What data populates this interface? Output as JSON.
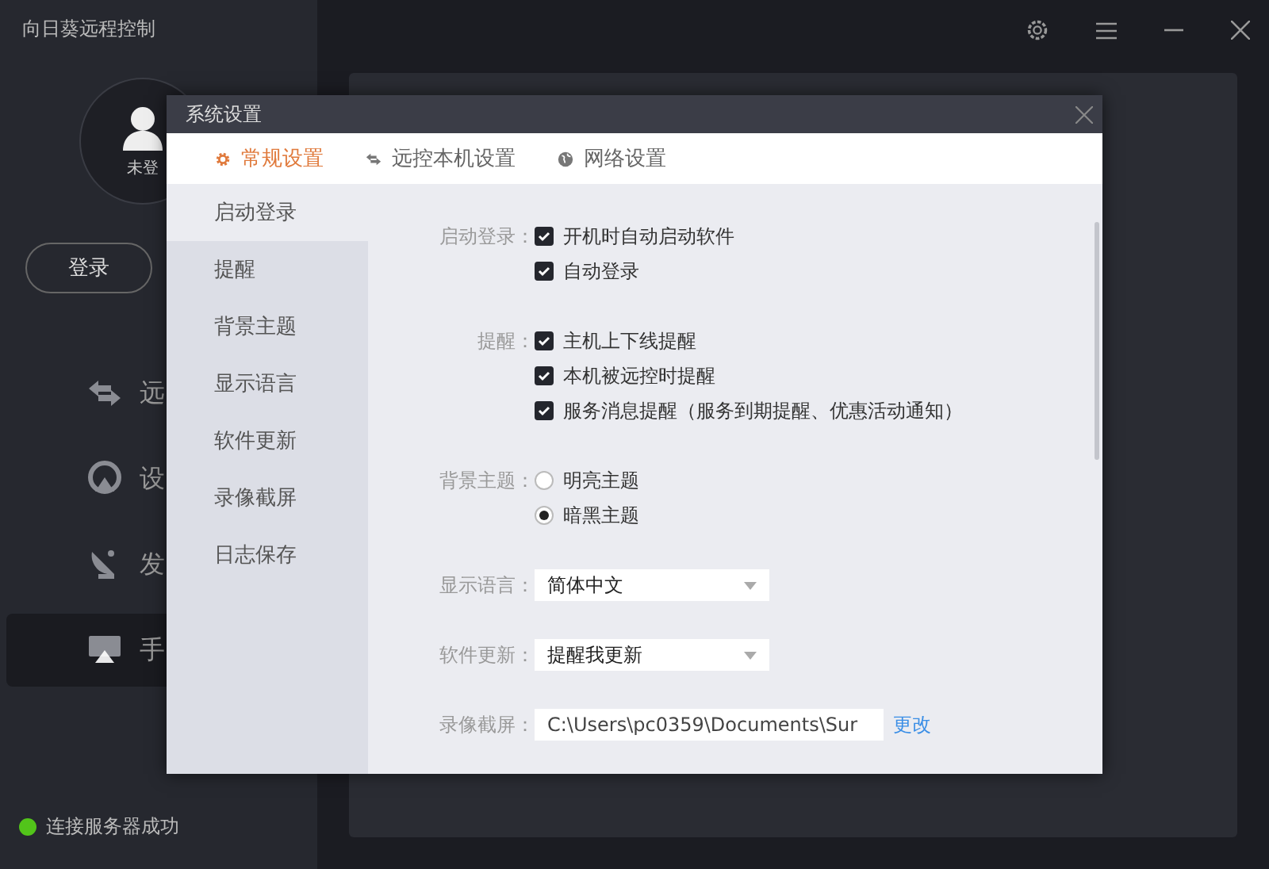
{
  "app": {
    "title": "向日葵远程控制",
    "avatar_label": "未登",
    "login_button": "登录",
    "nav": [
      {
        "label": "远",
        "selected": false
      },
      {
        "label": "设",
        "selected": false
      },
      {
        "label": "发",
        "selected": false
      },
      {
        "label": "手",
        "selected": true
      }
    ],
    "status": {
      "text": "连接服务器成功",
      "connected": true
    }
  },
  "dialog": {
    "title": "系统设置",
    "tabs": [
      {
        "label": "常规设置",
        "selected": true
      },
      {
        "label": "远控本机设置",
        "selected": false
      },
      {
        "label": "网络设置",
        "selected": false
      }
    ],
    "sections": [
      {
        "label": "启动登录",
        "selected": true
      },
      {
        "label": "提醒",
        "selected": false
      },
      {
        "label": "背景主题",
        "selected": false
      },
      {
        "label": "显示语言",
        "selected": false
      },
      {
        "label": "软件更新",
        "selected": false
      },
      {
        "label": "录像截屏",
        "selected": false
      },
      {
        "label": "日志保存",
        "selected": false
      }
    ],
    "groups": [
      {
        "label": "启动登录：",
        "kind": "checkbox",
        "options": [
          {
            "label": "开机时自动启动软件",
            "checked": true
          },
          {
            "label": "自动登录",
            "checked": true
          }
        ]
      },
      {
        "label": "提醒：",
        "kind": "checkbox",
        "options": [
          {
            "label": "主机上下线提醒",
            "checked": true
          },
          {
            "label": "本机被远控时提醒",
            "checked": true
          },
          {
            "label": "服务消息提醒（服务到期提醒、优惠活动通知）",
            "checked": true
          }
        ]
      },
      {
        "label": "背景主题：",
        "kind": "radio",
        "options": [
          {
            "label": "明亮主题",
            "selected": false
          },
          {
            "label": "暗黑主题",
            "selected": true
          }
        ]
      },
      {
        "label": "显示语言：",
        "kind": "select",
        "value": "简体中文"
      },
      {
        "label": "软件更新：",
        "kind": "select",
        "value": "提醒我更新"
      },
      {
        "label": "录像截屏：",
        "kind": "path",
        "value": "C:\\Users\\pc0359\\Documents\\Sur",
        "link": "更改"
      }
    ]
  }
}
